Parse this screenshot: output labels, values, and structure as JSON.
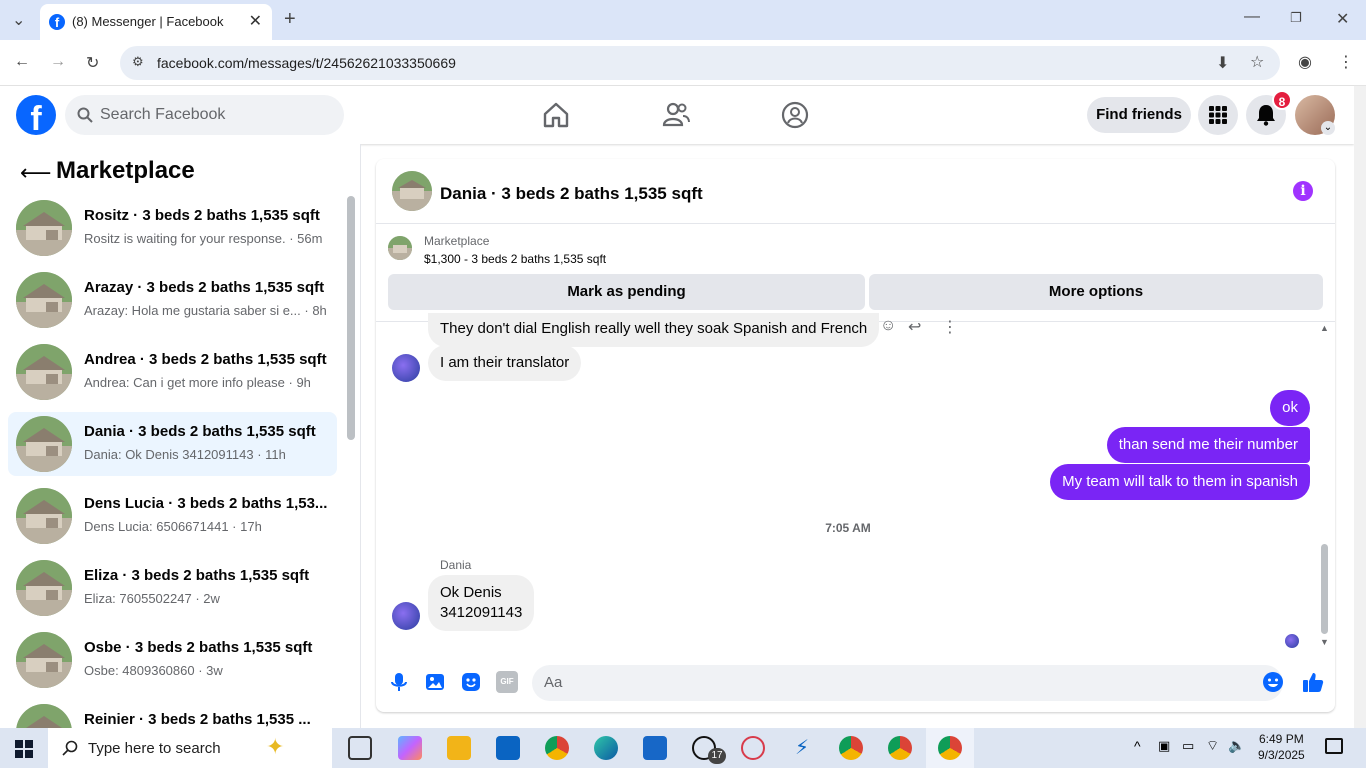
{
  "browser": {
    "tab_title": "(8) Messenger | Facebook",
    "url": "facebook.com/messages/t/24562621033350669",
    "new_tab_label": "+"
  },
  "header": {
    "search_placeholder": "Search Facebook",
    "find_friends": "Find friends",
    "notification_count": "8"
  },
  "left": {
    "title": "Marketplace",
    "conversations": [
      {
        "name": "Rositz · 3 beds 2 baths 1,535 sqft",
        "preview": "Rositz is waiting for your response. · 56m",
        "active": false
      },
      {
        "name": "Arazay · 3 beds 2 baths 1,535 sqft",
        "preview": "Arazay: Hola me gustaria saber si e... · 8h",
        "active": false
      },
      {
        "name": "Andrea · 3 beds 2 baths 1,535 sqft",
        "preview": "Andrea: Can i get more info please · 9h",
        "active": false
      },
      {
        "name": "Dania · 3 beds 2 baths 1,535 sqft",
        "preview": "Dania: Ok Denis 3412091143 · 11h",
        "active": true
      },
      {
        "name": "Dens Lucia · 3 beds 2 baths 1,53...",
        "preview": "Dens Lucia: 6506671441 · 17h",
        "active": false
      },
      {
        "name": "Eliza · 3 beds 2 baths 1,535 sqft",
        "preview": "Eliza: 7605502247 · 2w",
        "active": false
      },
      {
        "name": "Osbe · 3 beds 2 baths 1,535 sqft",
        "preview": "Osbe: 4809360860 · 3w",
        "active": false
      },
      {
        "name": "Reinier · 3 beds 2 baths 1,535 ...",
        "preview": "",
        "active": false
      }
    ]
  },
  "chat": {
    "title": "Dania · 3 beds 2 baths 1,535 sqft",
    "marketplace_label": "Marketplace",
    "listing": "$1,300 - 3 beds 2 baths 1,535 sqft",
    "mark_pending": "Mark as pending",
    "more_options": "More options",
    "messages": {
      "m1": "They don't dial English really well they soak Spanish and French",
      "m2": "I am their translator",
      "m3": "ok",
      "m4": "than send me their number",
      "m5": "My team will talk to them in spanish",
      "timestamp": "7:05 AM",
      "sender": "Dania",
      "m6_line1": "Ok Denis",
      "m6_line2": "3412091143"
    },
    "composer_placeholder": "Aa",
    "gif_label": "GIF"
  },
  "taskbar": {
    "search_placeholder": "Type here to search",
    "time": "6:49 PM",
    "date": "9/3/2025",
    "whatsapp_badge": "17"
  },
  "colors": {
    "fb_blue": "#0866ff",
    "outgoing_bubble": "#7a25f5",
    "active_row": "#ebf5ff"
  }
}
